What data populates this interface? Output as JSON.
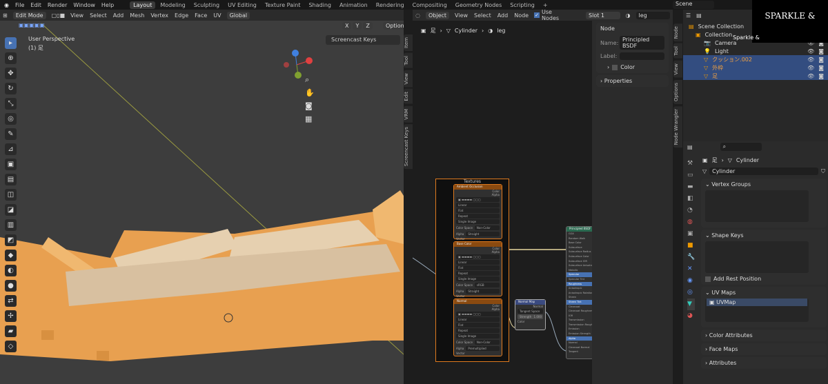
{
  "topbar": {
    "menus": [
      "File",
      "Edit",
      "Render",
      "Window",
      "Help"
    ],
    "workspaces": [
      "Layout",
      "Modeling",
      "Sculpting",
      "UV Editing",
      "Texture Paint",
      "Shading",
      "Animation",
      "Rendering",
      "Compositing",
      "Geometry Nodes",
      "Scripting",
      "+"
    ],
    "active": "Layout",
    "scene": "Scene"
  },
  "viewport": {
    "mode": "Edit Mode",
    "menus": [
      "View",
      "Select",
      "Add",
      "Mesh",
      "Vertex",
      "Edge",
      "Face",
      "UV"
    ],
    "orientation": "Global",
    "axes": [
      "X",
      "Y",
      "Z"
    ],
    "options": "Options",
    "title": "User Perspective",
    "subtitle": "(1) 足",
    "screencast": "Screencast Keys",
    "side_tabs": [
      "Item",
      "Tool",
      "View",
      "Edit",
      "VRM",
      "Screencast Keys"
    ]
  },
  "node_editor": {
    "object_mode": "Object",
    "menus": [
      "View",
      "Select",
      "Add",
      "Node"
    ],
    "use_nodes": "Use Nodes",
    "slot": "Slot 1",
    "material": "leg",
    "breadcrumb": [
      "足",
      "Cylinder",
      "leg"
    ],
    "npanel": {
      "section": "Node",
      "name_label": "Name:",
      "name_value": "Principled BSDF",
      "label_label": "Label:",
      "color": "Color",
      "properties": "Properties"
    },
    "side_tabs": [
      "Node",
      "Tool",
      "View",
      "Options",
      "Node Wrangler"
    ],
    "frame": "Textures",
    "tex_nodes": [
      {
        "title": "Ambient Occlusion",
        "cs": "Non-Color",
        "alpha": "Straight"
      },
      {
        "title": "Base Color",
        "cs": "sRGB",
        "alpha": "Straight"
      },
      {
        "title": "Normal",
        "cs": "Non-Color",
        "alpha": "Premultiplied"
      }
    ],
    "tex_rows": [
      "Linear",
      "Flat",
      "Repeat",
      "Single Image"
    ],
    "color_out": "Color",
    "alpha_out": "Alpha",
    "vector_in": "Vector",
    "color_space": "Color Space",
    "alpha": "Alpha",
    "normal_map": {
      "title": "Normal Map",
      "out": "Normal",
      "space": "Tangent Space",
      "strength_label": "Strength",
      "strength": "1.000",
      "in": "Color"
    },
    "bsdf": {
      "title": "Principled BSDF",
      "inputs": [
        "GGX",
        "Random Walk",
        "Base Color",
        "Subsurface",
        "Subsurface Radius",
        "Subsurface Color",
        "Subsurface IOR",
        "Subsurface Anisotropy",
        "Metallic",
        "Specular",
        "Specular Tint",
        "Roughness",
        "Anisotropic",
        "Anisotropic Rotation",
        "Sheen",
        "Sheen Tint",
        "Clearcoat",
        "Clearcoat Roughness",
        "IOR",
        "Transmission",
        "Transmission Roughness",
        "Emission",
        "Emission Strength",
        "Alpha",
        "Normal",
        "Clearcoat Normal",
        "Tangent"
      ]
    }
  },
  "outliner": {
    "items": [
      {
        "name": "Scene Collection",
        "sel": false
      },
      {
        "name": "Collection",
        "sel": false
      },
      {
        "name": "Camera",
        "sel": false
      },
      {
        "name": "Light",
        "sel": false
      },
      {
        "name": "クッション.002",
        "sel": true
      },
      {
        "name": "外枠",
        "sel": true
      },
      {
        "name": "足",
        "sel": true
      }
    ]
  },
  "overlay": {
    "logo": "SPARKLE &",
    "caption": "Sparkle &"
  },
  "properties": {
    "breadcrumb_obj": "足",
    "breadcrumb_mesh": "Cylinder",
    "mesh_name": "Cylinder",
    "vertex_groups": "Vertex Groups",
    "shape_keys": "Shape Keys",
    "add_rest": "Add Rest Position",
    "uv_maps": "UV Maps",
    "uv_item": "UVMap",
    "color_attributes": "Color Attributes",
    "face_maps": "Face Maps",
    "attributes": "Attributes"
  }
}
